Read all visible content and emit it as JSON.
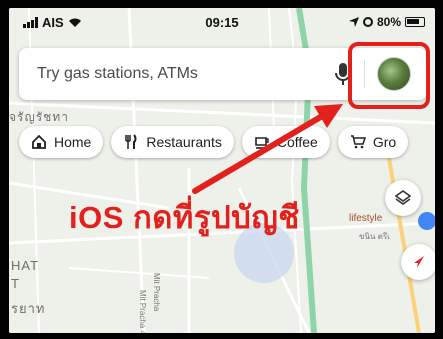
{
  "status_bar": {
    "carrier": "AIS",
    "time": "09:15",
    "battery": "80%"
  },
  "search": {
    "placeholder": "Try gas stations, ATMs"
  },
  "chips": [
    {
      "label": "Home",
      "icon": "home-icon"
    },
    {
      "label": "Restaurants",
      "icon": "fork-knife-icon"
    },
    {
      "label": "Coffee",
      "icon": "coffee-cup-icon"
    },
    {
      "label": "Gro",
      "icon": "cart-icon"
    }
  ],
  "map_labels": {
    "thai_top": "จรัญรัชทา",
    "area_1": "HAT",
    "area_2": "T",
    "thai_bottom": "รยาท",
    "road_1": "Mit Pracha",
    "road_2": "Mit Pracha 4",
    "poi": "lifestyle",
    "poi_sub": "ขนิน ตรีเ"
  },
  "annotation": {
    "text": "iOS กดที่รูปบัญชี"
  },
  "colors": {
    "annotation_red": "#e3211c",
    "map_background": "#eef0ea",
    "road_green": "#8fd3a8",
    "location_blue": "#4285f4"
  }
}
